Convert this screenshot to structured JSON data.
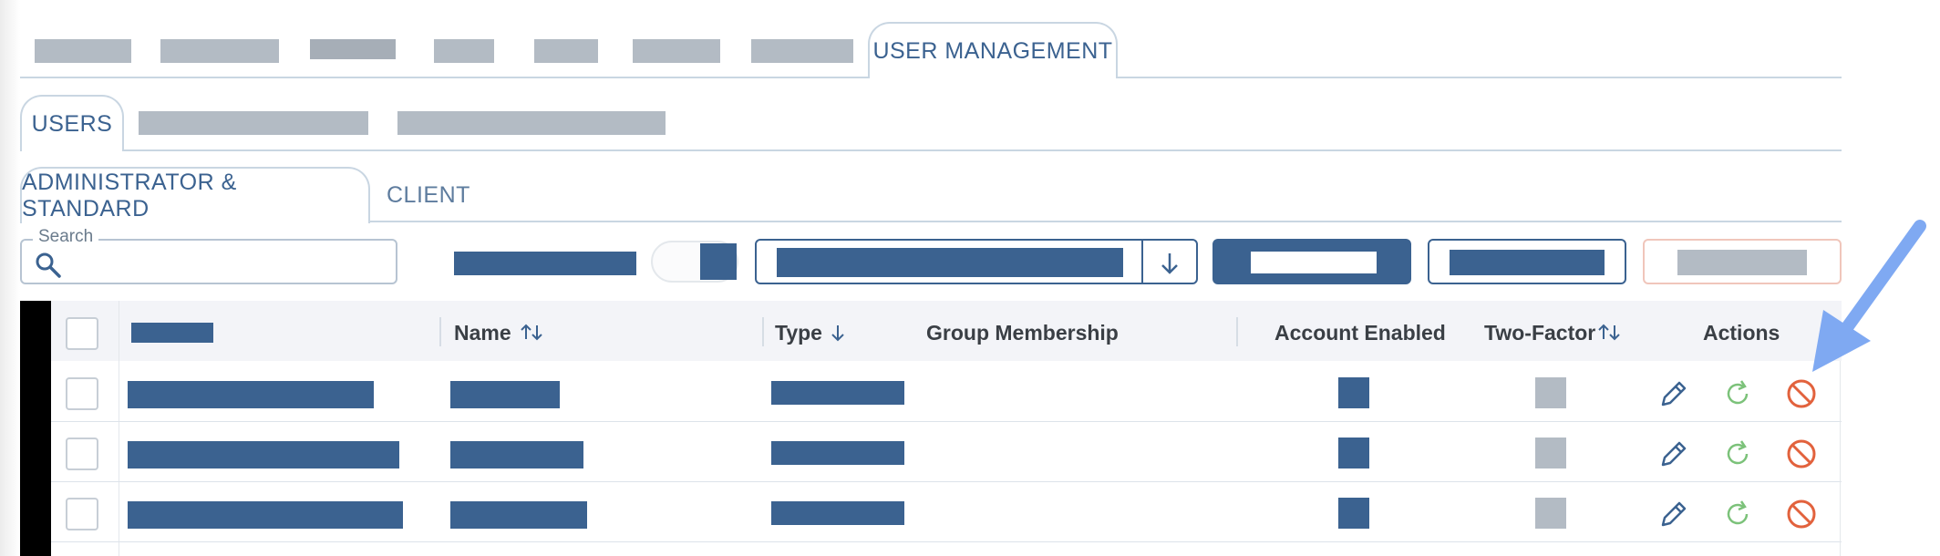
{
  "tabs_top": {
    "active_label": "USER MANAGEMENT"
  },
  "tabs_sub": {
    "active_label": "USERS"
  },
  "tabs_user_type": {
    "items": [
      "ADMINISTRATOR & STANDARD",
      "CLIENT"
    ]
  },
  "search": {
    "label": "Search",
    "placeholder": "",
    "icon": "search-icon"
  },
  "table": {
    "headers": {
      "name": "Name",
      "type": "Type",
      "group_membership": "Group Membership",
      "account_enabled": "Account Enabled",
      "two_factor": "Two-Factor",
      "actions": "Actions"
    },
    "sort_icons": {
      "name": "sort-both-icon",
      "type": "sort-descending-icon",
      "two_factor": "sort-both-icon"
    },
    "row_count": 3,
    "row_action_icons": [
      "edit-pencil-icon",
      "reset-refresh-icon",
      "disable-block-icon"
    ]
  },
  "colors": {
    "primary": "#3b6290",
    "redacted": "#b3bbc4",
    "refresh_green": "#7cc27a",
    "danger": "#e2623d",
    "annotation_arrow": "#7fa9f2"
  }
}
